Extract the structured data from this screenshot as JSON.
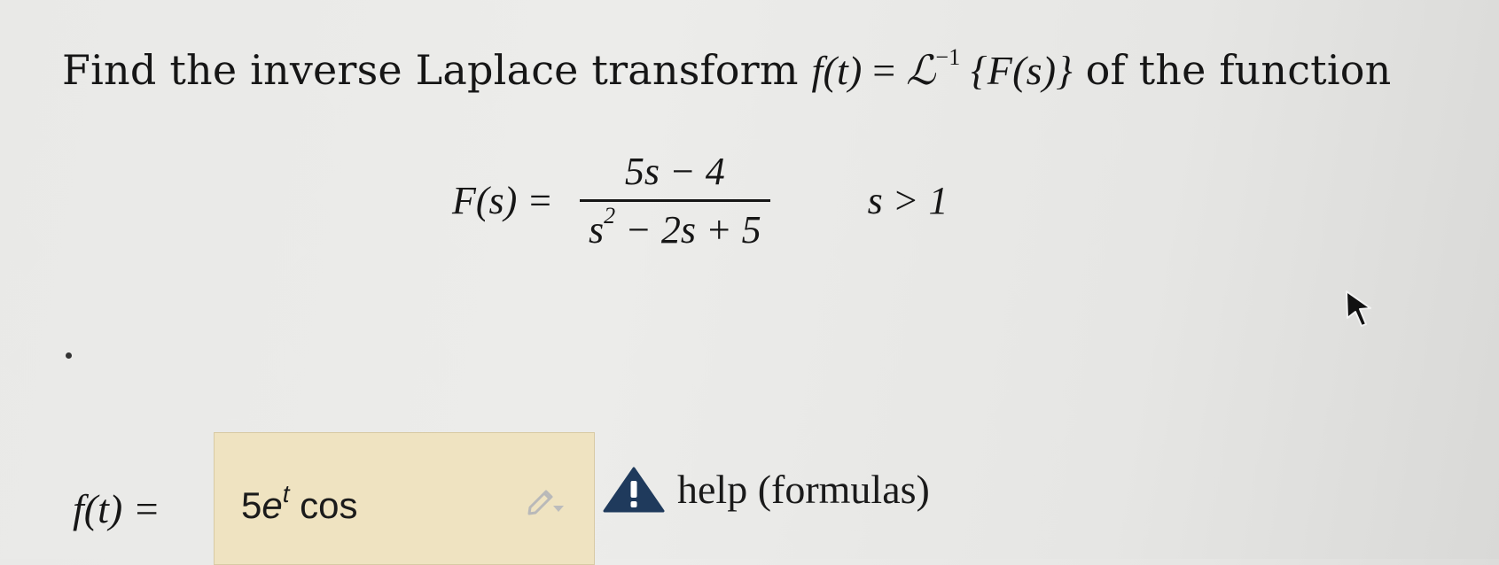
{
  "question": {
    "prefix": "Find the inverse Laplace transform ",
    "f_of_t": "f(t)",
    "equals": " = ",
    "laplace_symbol": "ℒ",
    "exponent": "−1",
    "braced": " {F(s)}",
    "suffix": " of the function"
  },
  "formula": {
    "lhs": "F(s) =",
    "numerator": "5s − 4",
    "denominator_base": "s",
    "denominator_exp": "2",
    "denominator_rest": " − 2s + 5",
    "condition": "s > 1"
  },
  "answer": {
    "label": "f(t) =",
    "coef": "5",
    "e": "e",
    "exp": "t",
    "func": " cos",
    "edit_icon": "pencil-dropdown-icon"
  },
  "help": {
    "icon": "warning-triangle-icon",
    "text": "help (formulas)"
  }
}
